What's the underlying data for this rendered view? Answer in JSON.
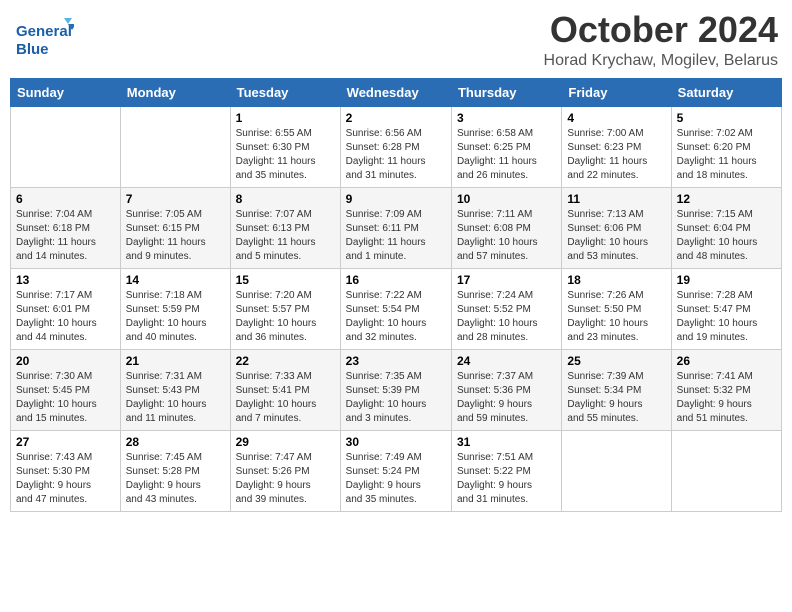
{
  "logo": {
    "line1": "General",
    "line2": "Blue"
  },
  "title": "October 2024",
  "subtitle": "Horad Krychaw, Mogilev, Belarus",
  "days_header": [
    "Sunday",
    "Monday",
    "Tuesday",
    "Wednesday",
    "Thursday",
    "Friday",
    "Saturday"
  ],
  "weeks": [
    [
      {
        "num": "",
        "info": ""
      },
      {
        "num": "",
        "info": ""
      },
      {
        "num": "1",
        "info": "Sunrise: 6:55 AM\nSunset: 6:30 PM\nDaylight: 11 hours\nand 35 minutes."
      },
      {
        "num": "2",
        "info": "Sunrise: 6:56 AM\nSunset: 6:28 PM\nDaylight: 11 hours\nand 31 minutes."
      },
      {
        "num": "3",
        "info": "Sunrise: 6:58 AM\nSunset: 6:25 PM\nDaylight: 11 hours\nand 26 minutes."
      },
      {
        "num": "4",
        "info": "Sunrise: 7:00 AM\nSunset: 6:23 PM\nDaylight: 11 hours\nand 22 minutes."
      },
      {
        "num": "5",
        "info": "Sunrise: 7:02 AM\nSunset: 6:20 PM\nDaylight: 11 hours\nand 18 minutes."
      }
    ],
    [
      {
        "num": "6",
        "info": "Sunrise: 7:04 AM\nSunset: 6:18 PM\nDaylight: 11 hours\nand 14 minutes."
      },
      {
        "num": "7",
        "info": "Sunrise: 7:05 AM\nSunset: 6:15 PM\nDaylight: 11 hours\nand 9 minutes."
      },
      {
        "num": "8",
        "info": "Sunrise: 7:07 AM\nSunset: 6:13 PM\nDaylight: 11 hours\nand 5 minutes."
      },
      {
        "num": "9",
        "info": "Sunrise: 7:09 AM\nSunset: 6:11 PM\nDaylight: 11 hours\nand 1 minute."
      },
      {
        "num": "10",
        "info": "Sunrise: 7:11 AM\nSunset: 6:08 PM\nDaylight: 10 hours\nand 57 minutes."
      },
      {
        "num": "11",
        "info": "Sunrise: 7:13 AM\nSunset: 6:06 PM\nDaylight: 10 hours\nand 53 minutes."
      },
      {
        "num": "12",
        "info": "Sunrise: 7:15 AM\nSunset: 6:04 PM\nDaylight: 10 hours\nand 48 minutes."
      }
    ],
    [
      {
        "num": "13",
        "info": "Sunrise: 7:17 AM\nSunset: 6:01 PM\nDaylight: 10 hours\nand 44 minutes."
      },
      {
        "num": "14",
        "info": "Sunrise: 7:18 AM\nSunset: 5:59 PM\nDaylight: 10 hours\nand 40 minutes."
      },
      {
        "num": "15",
        "info": "Sunrise: 7:20 AM\nSunset: 5:57 PM\nDaylight: 10 hours\nand 36 minutes."
      },
      {
        "num": "16",
        "info": "Sunrise: 7:22 AM\nSunset: 5:54 PM\nDaylight: 10 hours\nand 32 minutes."
      },
      {
        "num": "17",
        "info": "Sunrise: 7:24 AM\nSunset: 5:52 PM\nDaylight: 10 hours\nand 28 minutes."
      },
      {
        "num": "18",
        "info": "Sunrise: 7:26 AM\nSunset: 5:50 PM\nDaylight: 10 hours\nand 23 minutes."
      },
      {
        "num": "19",
        "info": "Sunrise: 7:28 AM\nSunset: 5:47 PM\nDaylight: 10 hours\nand 19 minutes."
      }
    ],
    [
      {
        "num": "20",
        "info": "Sunrise: 7:30 AM\nSunset: 5:45 PM\nDaylight: 10 hours\nand 15 minutes."
      },
      {
        "num": "21",
        "info": "Sunrise: 7:31 AM\nSunset: 5:43 PM\nDaylight: 10 hours\nand 11 minutes."
      },
      {
        "num": "22",
        "info": "Sunrise: 7:33 AM\nSunset: 5:41 PM\nDaylight: 10 hours\nand 7 minutes."
      },
      {
        "num": "23",
        "info": "Sunrise: 7:35 AM\nSunset: 5:39 PM\nDaylight: 10 hours\nand 3 minutes."
      },
      {
        "num": "24",
        "info": "Sunrise: 7:37 AM\nSunset: 5:36 PM\nDaylight: 9 hours\nand 59 minutes."
      },
      {
        "num": "25",
        "info": "Sunrise: 7:39 AM\nSunset: 5:34 PM\nDaylight: 9 hours\nand 55 minutes."
      },
      {
        "num": "26",
        "info": "Sunrise: 7:41 AM\nSunset: 5:32 PM\nDaylight: 9 hours\nand 51 minutes."
      }
    ],
    [
      {
        "num": "27",
        "info": "Sunrise: 7:43 AM\nSunset: 5:30 PM\nDaylight: 9 hours\nand 47 minutes."
      },
      {
        "num": "28",
        "info": "Sunrise: 7:45 AM\nSunset: 5:28 PM\nDaylight: 9 hours\nand 43 minutes."
      },
      {
        "num": "29",
        "info": "Sunrise: 7:47 AM\nSunset: 5:26 PM\nDaylight: 9 hours\nand 39 minutes."
      },
      {
        "num": "30",
        "info": "Sunrise: 7:49 AM\nSunset: 5:24 PM\nDaylight: 9 hours\nand 35 minutes."
      },
      {
        "num": "31",
        "info": "Sunrise: 7:51 AM\nSunset: 5:22 PM\nDaylight: 9 hours\nand 31 minutes."
      },
      {
        "num": "",
        "info": ""
      },
      {
        "num": "",
        "info": ""
      }
    ]
  ]
}
